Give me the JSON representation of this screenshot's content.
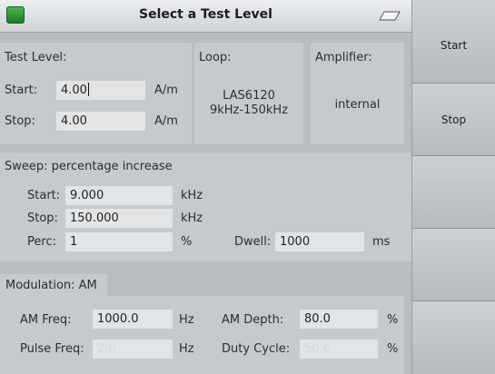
{
  "title": "Select a Test Level",
  "test_level": {
    "label": "Test Level:",
    "start_label": "Start:",
    "start_value": "4.00",
    "stop_label": "Stop:",
    "stop_value": "4.00",
    "unit": "A/m"
  },
  "loop": {
    "label": "Loop:",
    "name": "LAS6120",
    "range": "9kHz-150kHz"
  },
  "amplifier": {
    "label": "Amplifier:",
    "value": "internal"
  },
  "sweep": {
    "header": "Sweep: percentage increase",
    "start_label": "Start:",
    "start_value": "9.000",
    "start_unit": "kHz",
    "stop_label": "Stop:",
    "stop_value": "150.000",
    "stop_unit": "kHz",
    "perc_label": "Perc:",
    "perc_value": "1",
    "perc_unit": "%",
    "dwell_label": "Dwell:",
    "dwell_value": "1000",
    "dwell_unit": "ms"
  },
  "modulation": {
    "header": "Modulation: AM",
    "am_freq_label": "AM Freq:",
    "am_freq_value": "1000.0",
    "am_freq_unit": "Hz",
    "am_depth_label": "AM Depth:",
    "am_depth_value": "80.0",
    "am_depth_unit": "%",
    "pulse_freq_label": "Pulse Freq:",
    "pulse_freq_value": "2.0",
    "pulse_freq_unit": "Hz",
    "duty_cycle_label": "Duty Cycle:",
    "duty_cycle_value": "50.0",
    "duty_cycle_unit": "%"
  },
  "sidebar": {
    "start_label": "Start",
    "stop_label": "Stop"
  }
}
